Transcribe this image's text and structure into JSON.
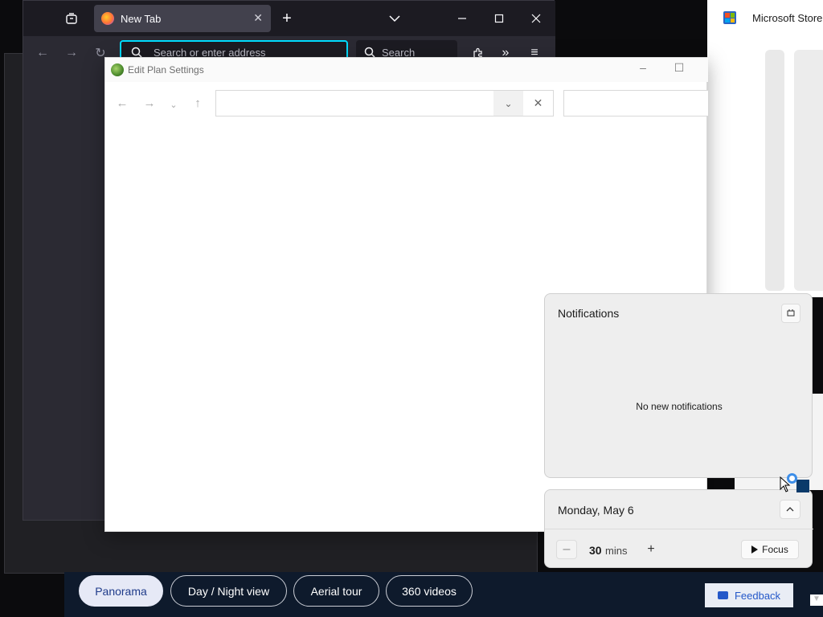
{
  "firefox": {
    "tab_title": "New Tab",
    "address_placeholder": "Search or enter address",
    "search_placeholder": "Search"
  },
  "store": {
    "title": "Microsoft Store"
  },
  "dialog": {
    "title": "Edit Plan Settings",
    "address_value": ""
  },
  "notifications": {
    "title": "Notifications",
    "empty_text": "No new notifications"
  },
  "calendar": {
    "date": "Monday, May 6",
    "focus_duration": "30",
    "focus_unit": "mins",
    "focus_label": "Focus"
  },
  "web_strip": {
    "pills": [
      "Panorama",
      "Day / Night view",
      "Aerial tour",
      "360 videos"
    ],
    "active_pill": "Panorama",
    "feedback_label": "Feedback"
  },
  "colors": {
    "firefox_bg": "#2b2a33",
    "firefox_focus_ring": "#00ddff",
    "strip_bg": "#0e1a2c",
    "accent_blue": "#2458c9"
  }
}
